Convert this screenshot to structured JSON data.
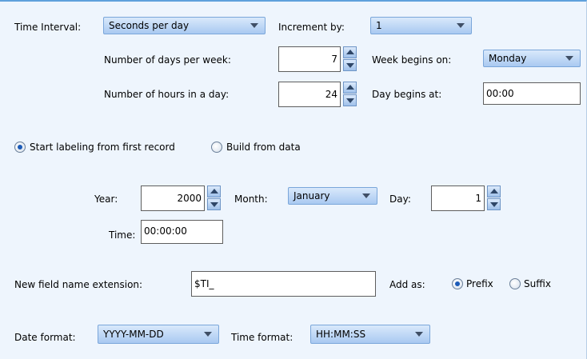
{
  "time_interval": {
    "label": "Time Interval:",
    "value": "Seconds per day",
    "increment_label": "Increment by:",
    "increment_value": "1"
  },
  "days_per_week": {
    "label": "Number of days per week:",
    "value": "7",
    "week_begins_label": "Week begins on:",
    "week_begins_value": "Monday"
  },
  "hours_per_day": {
    "label": "Number of hours in a day:",
    "value": "24",
    "day_begins_label": "Day begins at:",
    "day_begins_value": "00:00"
  },
  "labeling": {
    "option_first": "Start labeling from first record",
    "option_data": "Build from data",
    "selected": "first"
  },
  "start": {
    "year_label": "Year:",
    "year_value": "2000",
    "month_label": "Month:",
    "month_value": "January",
    "day_label": "Day:",
    "day_value": "1",
    "time_label": "Time:",
    "time_value": "00:00:00"
  },
  "extension": {
    "label": "New field name extension:",
    "value": "$TI_",
    "add_as_label": "Add as:",
    "prefix_label": "Prefix",
    "suffix_label": "Suffix",
    "selected": "prefix"
  },
  "formats": {
    "date_label": "Date format:",
    "date_value": "YYYY-MM-DD",
    "time_label": "Time format:",
    "time_value": "HH:MM:SS"
  },
  "colors": {
    "panel_background": "#eef5fd",
    "combo_gradient_top": "#d9e9fb",
    "combo_gradient_bottom": "#a9c9f1",
    "accent_border": "#5ea0dc",
    "radio_dot": "#1b5bb8"
  },
  "icons": {
    "dropdown": "chevron-down-icon",
    "spinner_up": "arrow-up-icon",
    "spinner_down": "arrow-down-icon"
  }
}
